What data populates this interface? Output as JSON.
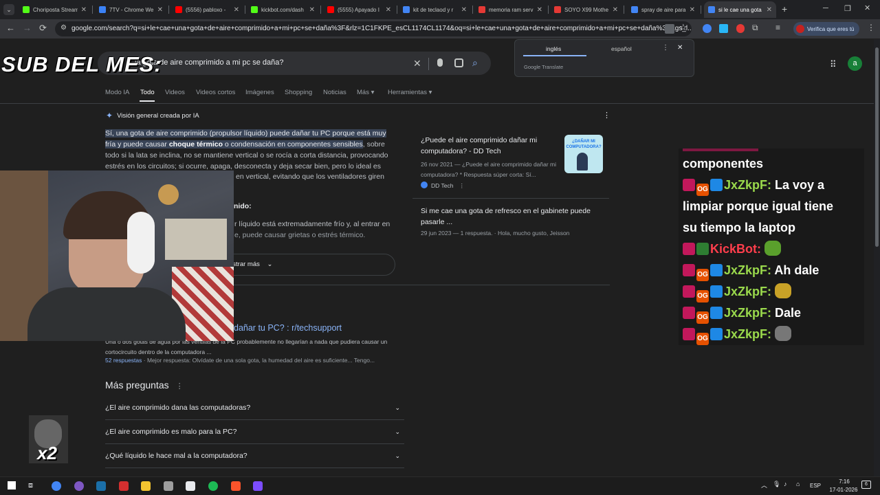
{
  "tabs": [
    {
      "title": "Choriposta Stream",
      "color": "#53fc18"
    },
    {
      "title": "7TV - Chrome We",
      "color": "#3b82f6"
    },
    {
      "title": "(5556) pabloxo -",
      "color": "#ff0000"
    },
    {
      "title": "kickbot.com/dash",
      "color": "#53fc18"
    },
    {
      "title": "(5555) Apayado I",
      "color": "#ff0000"
    },
    {
      "title": "kit de teclaod y r",
      "color": "#4285f4"
    },
    {
      "title": "memoria ram serv",
      "color": "#e53935"
    },
    {
      "title": "SOYO X99 Mothe",
      "color": "#e53935"
    },
    {
      "title": "spray de aire para",
      "color": "#4285f4"
    },
    {
      "title": "si le cae una gota",
      "color": "#4285f4"
    }
  ],
  "new_tab": "+",
  "window": {
    "minimize": "─",
    "maximize": "❐",
    "close": "✕",
    "tablist": "⌄"
  },
  "nav": {
    "back": "←",
    "forward": "→",
    "reload": "⟳"
  },
  "url": "google.com/search?q=si+le+cae+una+gota+de+aire+comprimido+a+mi+pc+se+daña%3F&rlz=1C1FKPE_esCL1174CL1174&oq=si+le+cae+una+gota+de+aire+comprimido+a+mi+pc+se+daña%3F&gs_l...",
  "profile_badge": "Verifica que eres tú",
  "overlay_title": "SUB DEL MES:",
  "search": {
    "query": "la gota de aire comprimido a mi pc se daña?"
  },
  "filters": [
    "Modo IA",
    "Todo",
    "Videos",
    "Videos cortos",
    "Imágenes",
    "Shopping",
    "Noticias",
    "Más ▾",
    "Herramientas ▾"
  ],
  "active_filter": "Todo",
  "avatar_letter": "a",
  "translate": {
    "lang1": "inglés",
    "lang2": "español",
    "footer": "Google Translate"
  },
  "ai": {
    "heading": "Visión general creada por IA",
    "highlighted": "Sí, una gota de aire comprimido (propulsor líquido) puede dañar tu PC porque está muy fría y puede causar ",
    "bold": "choque térmico",
    "highlighted2": " o condensación en componentes sensibles",
    "rest": ", sobre todo si la lata se inclina, no se mantiene vertical o se rocía a corta distancia, provocando estrés en los circuitos; si ocurre, apaga, desconecta y deja secar bien, pero lo ideal es",
    "line5": "en vertical, evitando que los ventiladores giren",
    "subheading": "nido:",
    "para2a": "r líquido está extremadamente frío y, al entrar en",
    "para2b": "e, puede causar grietas o estrés térmico.",
    "show_more": "ostrar más"
  },
  "card": {
    "title": "¿Puede el aire comprimido dañar mi computadora? - DD Tech",
    "date_desc": "26 nov 2021 — ¿Puede el aire comprimido dañar mi computadora? * Respuesta súper corta: Sí...",
    "source": "DD Tech",
    "thumb_text": "¿DAÑAR MI COMPUTADORA?",
    "q2": "Si me cae una gota de refresco en el gabinete puede pasarle ...",
    "q2_meta": "29 jun 2023 — 1 respuesta. · Hola, mucho gusto, Jeisson"
  },
  "reddit": {
    "title": "dañar tu PC? : r/techsupport",
    "snippet": "Una o dos gotas de agua por las ventilas de la PC probablemente no llegarían a nada que pudiera causar un cortocircuito dentro de la computadora ...",
    "answers": "52 respuestas",
    "best": " · Mejor respuesta: Olvídate de una sola gota, la humedad del aire es suficiente... Tengo..."
  },
  "more_questions": {
    "title": "Más preguntas",
    "items": [
      "¿El aire comprimido dana las computadoras?",
      "¿El aire comprimido es malo para la PC?",
      "¿Qué líquido le hace mal a la computadora?"
    ]
  },
  "chat": [
    {
      "user": "",
      "msg": "componentes"
    },
    {
      "user": "JxZkpF:",
      "msg": "La voy a"
    },
    {
      "user": "",
      "msg": "limpiar porque igual tiene"
    },
    {
      "user": "",
      "msg": "su tiempo la laptop"
    },
    {
      "user": "KickBot:",
      "msg": ""
    },
    {
      "user": "JxZkpF:",
      "msg": "Ah dale"
    },
    {
      "user": "JxZkpF:",
      "msg": ""
    },
    {
      "user": "JxZkpF:",
      "msg": "Dale"
    },
    {
      "user": "JxZkpF:",
      "msg": ""
    }
  ],
  "chat_badge": "OG",
  "x2_label": "x2",
  "taskbar": {
    "lang": "ESP",
    "time": "7:16",
    "date": "17-01-2026",
    "notif": "6"
  }
}
